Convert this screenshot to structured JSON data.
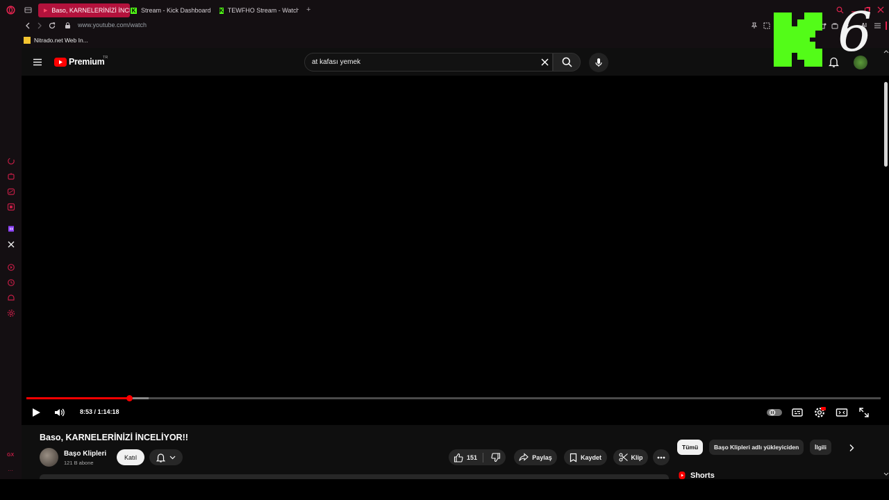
{
  "browser": {
    "tabs": [
      {
        "label": "Baso, KARNELERİNİZİ İNCE",
        "active": true
      },
      {
        "label": "Stream - Kick Dashboard",
        "active": false
      },
      {
        "label": "TEWFHO Stream - Watch L",
        "active": false
      }
    ],
    "url": "www.youtube.com/watch",
    "bookmark": "Nitrado.net Web In...",
    "ai_label": "AI",
    "accent_color": "#b3123c"
  },
  "youtube": {
    "logo_text": "Premium",
    "region": "TR",
    "search_value": "at kafası yemek",
    "player": {
      "time": "8:53 / 1:14:18",
      "progress_fraction": 0.12
    },
    "video_title": "Baso, KARNELERİNİZİ İNCELİYOR!!",
    "channel": {
      "name": "Başo Klipleri",
      "subscribers": "121 B abone",
      "join_label": "Katıl"
    },
    "actions": {
      "likes": "151",
      "share": "Paylaş",
      "save": "Kaydet",
      "clip": "Klip"
    },
    "chips": [
      "Tümü",
      "Başo Klipleri adlı yükleyiciden",
      "İlgili"
    ],
    "shorts_label": "Shorts"
  },
  "overlay": {
    "kick_letter_color": "#53fc18",
    "number": "6"
  }
}
